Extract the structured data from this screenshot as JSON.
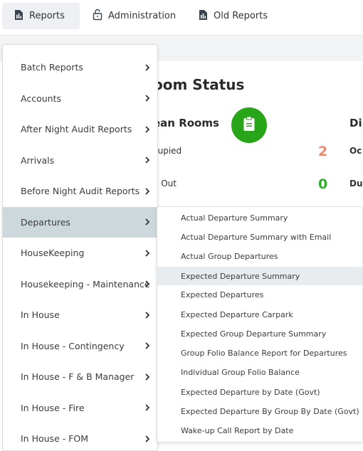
{
  "nav": {
    "tabs": [
      {
        "label": "Reports",
        "icon": "report-file-icon"
      },
      {
        "label": "Administration",
        "icon": "unlock-icon"
      },
      {
        "label": "Old Reports",
        "icon": "report-file-icon"
      }
    ]
  },
  "page": {
    "title": "oom Status",
    "clean_rooms": "ean Rooms",
    "next_heading": "Di",
    "rows": [
      {
        "label": "cupied",
        "value": "2",
        "color": "#e98a6e"
      },
      {
        "label": "e Out",
        "value": "0",
        "color": "#2fae2a"
      }
    ],
    "right_rows": [
      "Oc",
      "Du"
    ]
  },
  "menu": {
    "items": [
      "Batch Reports",
      "Accounts",
      "After Night Audit Reports",
      "Arrivals",
      "Before Night Audit Reports",
      "Departures",
      "HouseKeeping",
      "Housekeeping - Maintenance",
      "In House",
      "In House - Contingency",
      "In House - F & B Manager",
      "In House - Fire",
      "In House - FOM"
    ],
    "selected": "Departures"
  },
  "submenu": {
    "items": [
      "Actual Departure Summary",
      "Actual Departure Summary with Email",
      "Actual Group Departures",
      "Expected Departure Summary",
      "Expected Departures",
      "Expected Departure Carpark",
      "Expected Group Departure Summary",
      "Group Folio Balance Report for Departures",
      "Individual Group Folio Balance",
      "Expected Departure by Date (Govt)",
      "Expected Departure By Group By Date (Govt)",
      "Wake-up Call Report by Date"
    ],
    "highlighted": "Expected Departure Summary"
  },
  "colors": {
    "accent_green": "#28a519",
    "selected_bg": "#cdd8dc"
  }
}
